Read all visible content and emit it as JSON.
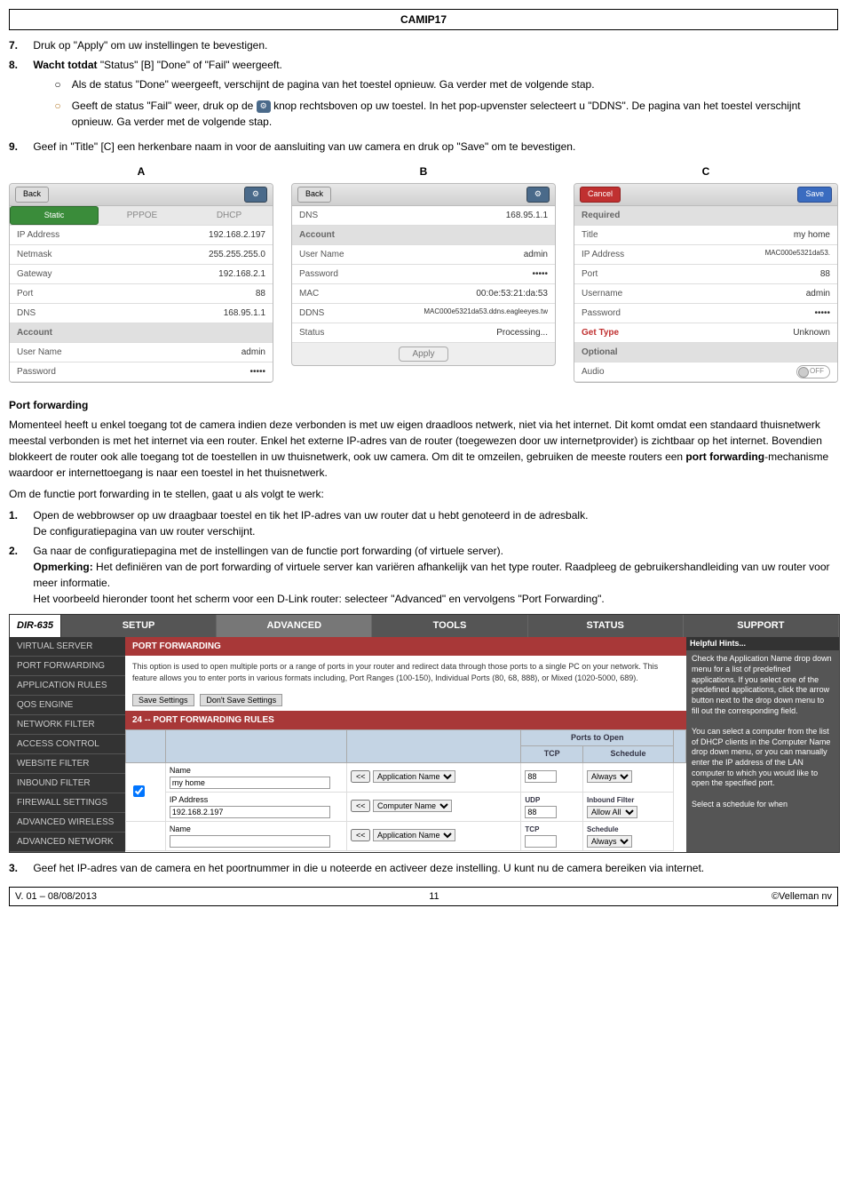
{
  "header": "CAMIP17",
  "steps": {
    "s7": {
      "num": "7.",
      "text": "Druk op \"Apply\" om uw instellingen te bevestigen."
    },
    "s8": {
      "num": "8.",
      "lead": "Wacht totdat",
      "tail": " \"Status\" [B] \"Done\" of \"Fail\" weergeeft.",
      "sub1": "Als de status \"Done\" weergeeft, verschijnt de pagina van het toestel opnieuw. Ga verder met de volgende stap.",
      "sub2a": "Geeft de status \"Fail\" weer, druk op de ",
      "sub2b": " knop rechtsboven op uw toestel. In het pop-upvenster selecteert u \"DDNS\". De pagina van het toestel verschijnt opnieuw. Ga verder met de volgende stap."
    },
    "s9": {
      "num": "9.",
      "text": "Geef in \"Title\" [C] een herkenbare naam in voor de aansluiting van uw camera en druk op \"Save\" om te bevestigen."
    }
  },
  "panelA": {
    "label": "A",
    "back": "Back",
    "tabs": {
      "static": "Static",
      "pppoe": "PPPOE",
      "dhcp": "DHCP"
    },
    "rows": {
      "ip": {
        "k": "IP Address",
        "v": "192.168.2.197"
      },
      "netmask": {
        "k": "Netmask",
        "v": "255.255.255.0"
      },
      "gateway": {
        "k": "Gateway",
        "v": "192.168.2.1"
      },
      "port": {
        "k": "Port",
        "v": "88"
      },
      "dns": {
        "k": "DNS",
        "v": "168.95.1.1"
      },
      "account": "Account",
      "user": {
        "k": "User Name",
        "v": "admin"
      },
      "pass": {
        "k": "Password",
        "v": "•••••"
      }
    }
  },
  "panelB": {
    "label": "B",
    "back": "Back",
    "rows": {
      "dns": {
        "k": "DNS",
        "v": "168.95.1.1"
      },
      "account": "Account",
      "user": {
        "k": "User Name",
        "v": "admin"
      },
      "pass": {
        "k": "Password",
        "v": "•••••"
      },
      "mac": {
        "k": "MAC",
        "v": "00:0e:53:21:da:53"
      },
      "ddns": {
        "k": "DDNS",
        "v": "MAC000e5321da53.ddns.eagleeyes.tw"
      },
      "status": {
        "k": "Status",
        "v": "Processing..."
      }
    },
    "apply": "Apply"
  },
  "panelC": {
    "label": "C",
    "cancel": "Cancel",
    "save": "Save",
    "required": "Required",
    "rows": {
      "title": {
        "k": "Title",
        "v": "my home"
      },
      "ip": {
        "k": "IP Address",
        "v": "MAC000e5321da53."
      },
      "port": {
        "k": "Port",
        "v": "88"
      },
      "user": {
        "k": "Username",
        "v": "admin"
      },
      "pass": {
        "k": "Password",
        "v": "•••••"
      },
      "gettype": {
        "k": "Get Type",
        "v": "Unknown"
      },
      "optional": "Optional",
      "audio": {
        "k": "Audio",
        "v": "OFF"
      }
    }
  },
  "pf": {
    "title": "Port forwarding",
    "para1": "Momenteel heeft u enkel toegang tot de camera indien deze verbonden is met uw eigen draadloos netwerk, niet via het internet. Dit komt omdat een standaard thuisnetwerk meestal verbonden is met het internet via een router. Enkel het externe IP-adres van de router (toegewezen door uw internetprovider) is zichtbaar op het internet. Bovendien blokkeert de router ook alle toegang tot de toestellen in uw thuisnetwerk, ook uw camera. Om dit te omzeilen, gebruiken de meeste routers een ",
    "pfword": "port forwarding",
    "para1b": "-mechanisme waardoor er internettoegang is naar een toestel in het thuisnetwerk.",
    "para2": "Om de functie port forwarding in te stellen, gaat u als volgt te werk:",
    "step1num": "1.",
    "step1": "Open de webbrowser op uw draagbaar toestel en tik het IP-adres van uw router dat u hebt genoteerd in de adresbalk.",
    "step1b": "De configuratiepagina van uw router verschijnt.",
    "step2num": "2.",
    "step2": "Ga naar de configuratiepagina met de instellingen van de functie port forwarding (of virtuele server).",
    "opmerking": "Opmerking:",
    "step2b": " Het definiëren van de port forwarding of virtuele server kan variëren afhankelijk van het type router. Raadpleeg de gebruikershandleiding van uw router voor meer informatie.",
    "step2c": "Het voorbeeld hieronder toont het scherm voor een D-Link router: selecteer \"Advanced\" en vervolgens \"Port Forwarding\".",
    "step3num": "3.",
    "step3": "Geef het IP-adres van de camera en het poortnummer in die u noteerde en activeer deze instelling. U kunt nu de camera bereiken via internet."
  },
  "router": {
    "logo": "DIR-635",
    "tabs": [
      "SETUP",
      "ADVANCED",
      "TOOLS",
      "STATUS",
      "SUPPORT"
    ],
    "side": [
      "VIRTUAL SERVER",
      "PORT FORWARDING",
      "APPLICATION RULES",
      "QOS ENGINE",
      "NETWORK FILTER",
      "ACCESS CONTROL",
      "WEBSITE FILTER",
      "INBOUND FILTER",
      "FIREWALL SETTINGS",
      "ADVANCED WIRELESS",
      "ADVANCED NETWORK"
    ],
    "pf_title": "PORT FORWARDING",
    "pf_desc": "This option is used to open multiple ports or a range of ports in your router and redirect data through those ports to a single PC on your network. This feature allows you to enter ports in various formats including, Port Ranges (100-150), Individual Ports (80, 68, 888), or Mixed (1020-5000, 689).",
    "btn_save": "Save Settings",
    "btn_dont": "Don't Save Settings",
    "rules_title": "24 -- PORT FORWARDING RULES",
    "th": {
      "ports": "Ports to Open",
      "tcp": "TCP",
      "udp": "UDP",
      "sched": "Schedule",
      "inbound": "Inbound Filter"
    },
    "labels": {
      "name": "Name",
      "ip": "IP Address",
      "appname": "Application Name",
      "compname": "Computer Name"
    },
    "vals": {
      "name": "my home",
      "ip": "192.168.2.197",
      "tcp": "88",
      "udp": "88",
      "always": "Always",
      "allowall": "Allow All"
    },
    "hints_title": "Helpful Hints...",
    "hints": "Check the Application Name drop down menu for a list of predefined applications. If you select one of the predefined applications, click the arrow button next to the drop down menu to fill out the corresponding field.\n\nYou can select a computer from the list of DHCP clients in the Computer Name drop down menu, or you can manually enter the IP address of the LAN computer to which you would like to open the specified port.\n\nSelect a schedule for when"
  },
  "footer": {
    "left": "V. 01 – 08/08/2013",
    "center": "11",
    "right": "©Velleman nv"
  }
}
